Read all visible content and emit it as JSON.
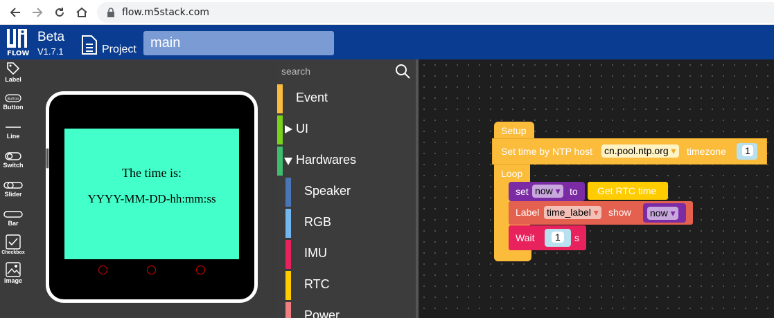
{
  "browser": {
    "url": "flow.m5stack.com"
  },
  "app": {
    "beta_label": "Beta",
    "version": "V1.7.1",
    "project_label": "Project",
    "project_name": "main"
  },
  "toolbar": {
    "items": [
      {
        "label": "Label",
        "icon": "tag-icon"
      },
      {
        "label": "Button",
        "icon": "button-icon"
      },
      {
        "label": "Line",
        "icon": "line-icon"
      },
      {
        "label": "Switch",
        "icon": "switch-icon"
      },
      {
        "label": "Slider",
        "icon": "slider-icon"
      },
      {
        "label": "Bar",
        "icon": "bar-icon"
      },
      {
        "label": "Checkbox",
        "icon": "checkbox-icon"
      },
      {
        "label": "Image",
        "icon": "image-icon"
      }
    ],
    "button_icon_text": "Button"
  },
  "preview": {
    "screen_color": "#43ffc9",
    "label1": "The time is:",
    "label2": "YYYY-MM-DD-hh:mm:ss"
  },
  "palette": {
    "search_placeholder": "search",
    "categories": [
      {
        "label": "Event",
        "color": "#fbbc3c"
      },
      {
        "label": "UI",
        "color": "#7ad11a"
      },
      {
        "label": "Hardwares",
        "color": "#3fbd6e"
      }
    ],
    "subcategories": [
      {
        "label": "Speaker",
        "color": "#4a76b5"
      },
      {
        "label": "RGB",
        "color": "#74b7f0"
      },
      {
        "label": "IMU",
        "color": "#e8225c"
      },
      {
        "label": "RTC",
        "color": "#ffcc00"
      },
      {
        "label": "Power",
        "color": "#f08080"
      }
    ]
  },
  "blocks": {
    "setup": "Setup",
    "ntp_prefix": "Set time by NTP host",
    "ntp_host": "cn.pool.ntp.org",
    "ntp_timezone_label": "timezone",
    "ntp_timezone": "1",
    "loop": "Loop",
    "set_label": "set",
    "var_now": "now",
    "to_label": "to",
    "get_rtc": "Get RTC time",
    "label_label": "Label",
    "label_var": "time_label",
    "show_label": "show",
    "show_var": "now",
    "wait_label": "Wait",
    "wait_value": "1",
    "wait_unit": "s"
  }
}
